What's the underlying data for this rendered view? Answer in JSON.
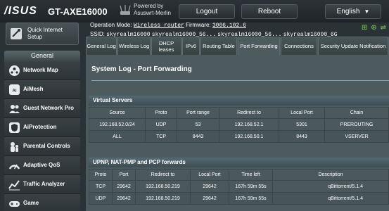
{
  "header": {
    "logo": "/ISUS",
    "model": "GT-AXE16000",
    "powered_by_1": "Powered by",
    "powered_by_2": "Asuswrt-Merlin",
    "logout_label": "Logout",
    "reboot_label": "Reboot",
    "language_label": "English"
  },
  "info": {
    "op_mode_label": "Operation Mode:",
    "op_mode_value": "Wireless router",
    "firmware_label": "Firmware:",
    "firmware_value": "3006.102.6",
    "ssid_label": "SSID:",
    "ssids": [
      "skyrealm16000",
      "skyrealm16000_56...",
      "skyrealm16000_56...",
      "skyrealm16000_6G"
    ]
  },
  "sidebar": {
    "qis_label": "Quick Internet Setup",
    "general_header": "General",
    "items": [
      {
        "label": "Network Map",
        "icon": "network-map-icon"
      },
      {
        "label": "AiMesh",
        "icon": "aimesh-icon"
      },
      {
        "label": "Guest Network Pro",
        "icon": "guest-network-icon"
      },
      {
        "label": "AiProtection",
        "icon": "aiprotection-icon"
      },
      {
        "label": "Parental Controls",
        "icon": "parental-controls-icon"
      },
      {
        "label": "Adaptive QoS",
        "icon": "adaptive-qos-icon"
      },
      {
        "label": "Traffic Analyzer",
        "icon": "traffic-analyzer-icon"
      },
      {
        "label": "Game",
        "icon": "game-icon"
      }
    ]
  },
  "tabs": [
    {
      "label": "General Log",
      "active": false
    },
    {
      "label": "Wireless Log",
      "active": false
    },
    {
      "label": "DHCP leases",
      "active": false
    },
    {
      "label": "IPv6",
      "active": false
    },
    {
      "label": "Routing Table",
      "active": false
    },
    {
      "label": "Port Forwarding",
      "active": true
    },
    {
      "label": "Connections",
      "active": false
    },
    {
      "label": "Security Update Notification",
      "active": false
    }
  ],
  "page_title": "System Log - Port Forwarding",
  "virtual_servers": {
    "title": "Virtual Servers",
    "columns": [
      "Source",
      "Proto",
      "Port range",
      "Redirect to",
      "Local Port",
      "Chain"
    ],
    "rows": [
      [
        "192.168.52.0/24",
        "UDP",
        "53",
        "192.168.52.1",
        "5301",
        "PREROUTING"
      ],
      [
        "ALL",
        "TCP",
        "8443",
        "192.168.50.1",
        "8443",
        "VSERVER"
      ]
    ]
  },
  "upnp": {
    "title": "UPNP, NAT-PMP and PCP forwards",
    "columns": [
      "Proto",
      "Port",
      "Redirect to",
      "Local Port",
      "Time left",
      "Description"
    ],
    "rows": [
      [
        "TCP",
        "29642",
        "192.168.50.219",
        "29642",
        "167h 59m 55s",
        "qBittorrent/5.1.4"
      ],
      [
        "UDP",
        "29642",
        "192.168.50.219",
        "29642",
        "167h 59m 55s",
        "qBittorrent/5.1.4"
      ]
    ]
  },
  "colors": {
    "accent": "#7ea3b3",
    "status_green": "#7bd35a"
  }
}
